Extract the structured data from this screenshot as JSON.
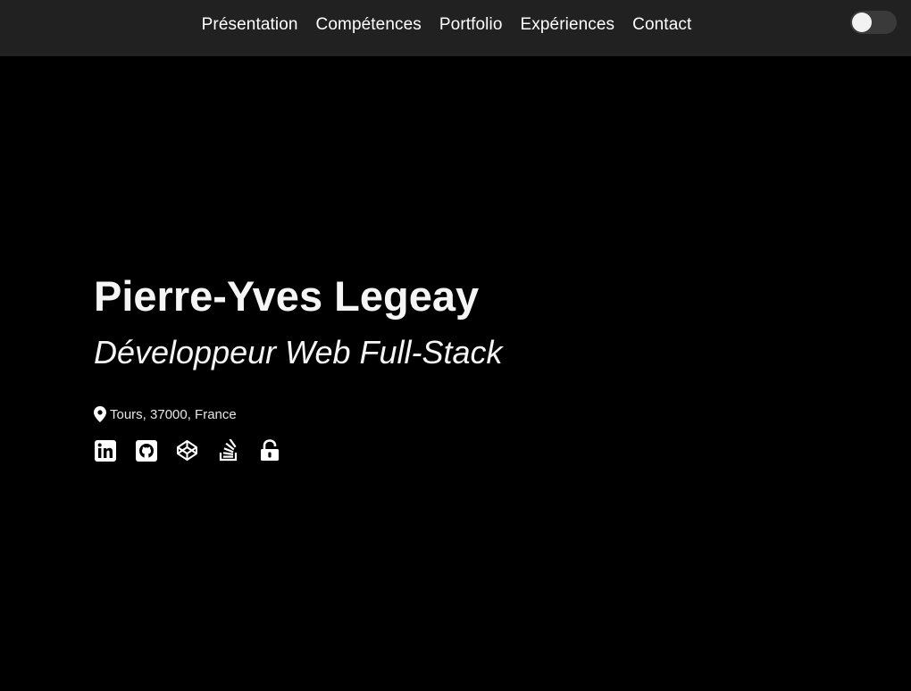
{
  "nav": {
    "links": [
      "Présentation",
      "Compétences",
      "Portfolio",
      "Expériences",
      "Contact"
    ]
  },
  "theme_toggle": {
    "state": "off",
    "icon": "toggle-icon"
  },
  "hero": {
    "name": "Pierre-Yves Legeay",
    "title": "Développeur Web Full-Stack",
    "location": "Tours, 37000, France",
    "location_icon": "map-marker-icon"
  },
  "socials": [
    {
      "icon": "linkedin-icon"
    },
    {
      "icon": "github-icon"
    },
    {
      "icon": "codepen-icon"
    },
    {
      "icon": "stack-overflow-icon"
    },
    {
      "icon": "unlock-icon"
    }
  ],
  "colors": {
    "background": "#000000",
    "navbar": "#212121",
    "text": "#ffffff"
  }
}
